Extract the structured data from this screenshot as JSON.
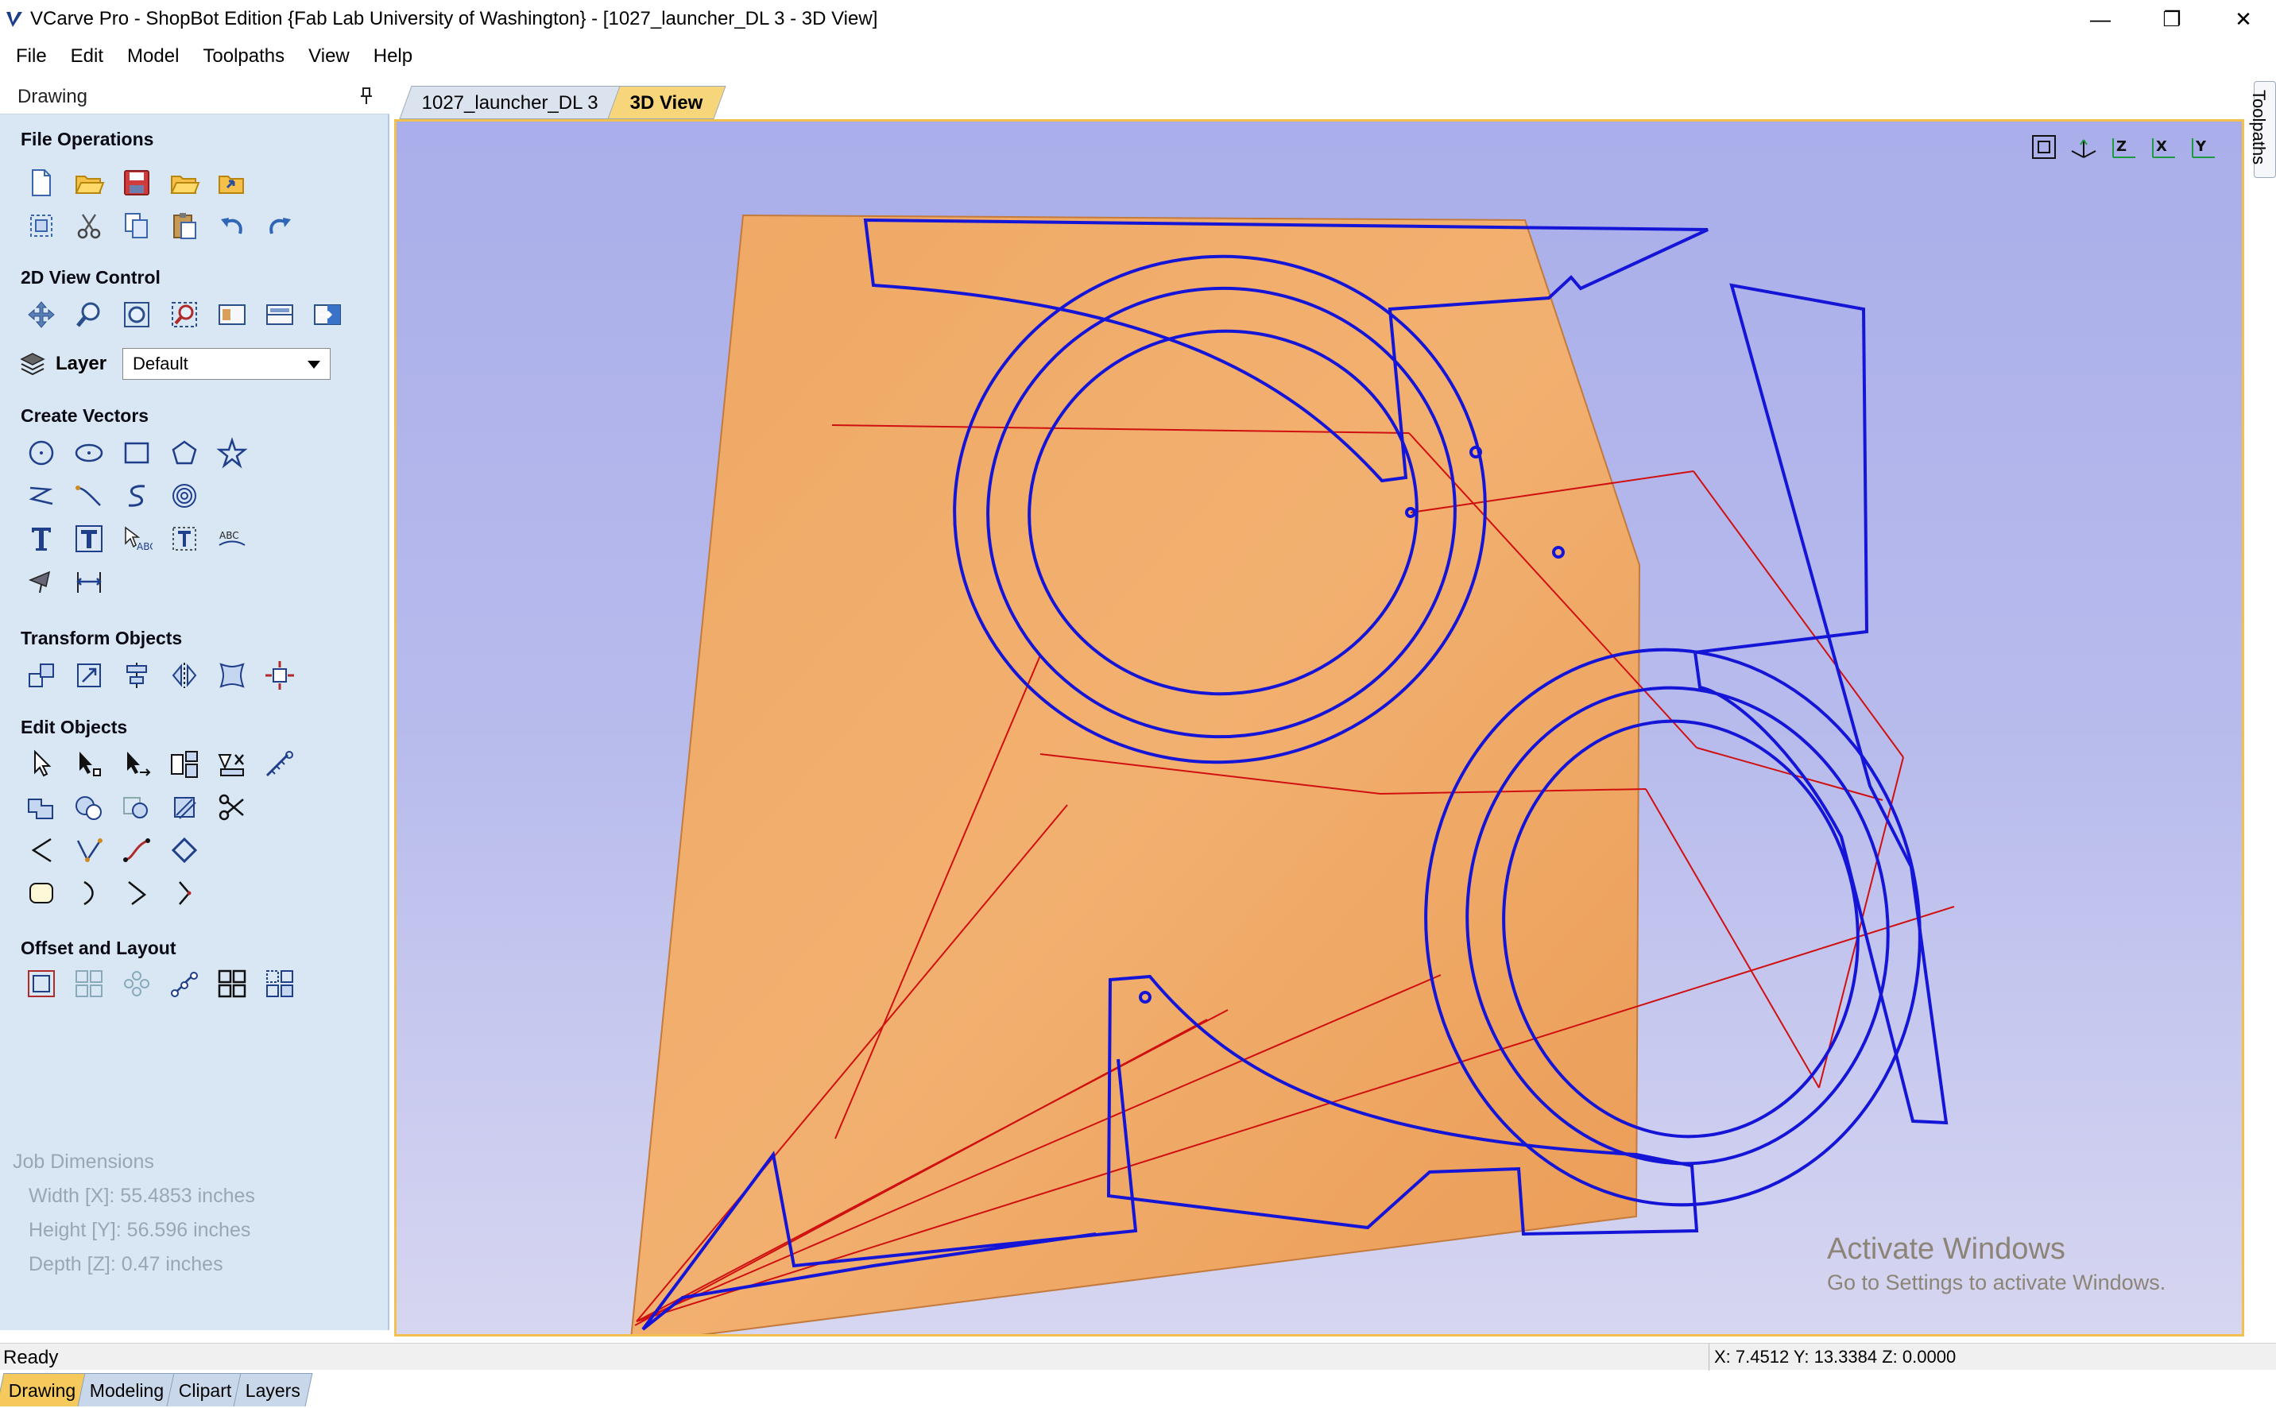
{
  "window": {
    "title": "VCarve Pro - ShopBot Edition {Fab Lab University of Washington} - [1027_launcher_DL 3 - 3D View]",
    "controls": [
      "—",
      "❐",
      "✕"
    ],
    "mdi_controls": [
      "–",
      "▭",
      "✕"
    ]
  },
  "menu": [
    "File",
    "Edit",
    "Model",
    "Toolpaths",
    "View",
    "Help"
  ],
  "panel": {
    "title": "Drawing",
    "sections": {
      "file_ops": "File Operations",
      "view_2d": "2D View Control",
      "create_vectors": "Create Vectors",
      "transform": "Transform Objects",
      "edit": "Edit Objects",
      "offset": "Offset and Layout"
    },
    "layer_label": "Layer",
    "layer_value": "Default",
    "tabs": [
      "Drawing",
      "Modeling",
      "Clipart",
      "Layers"
    ],
    "active_tab": "Drawing"
  },
  "job": {
    "heading": "Job Dimensions",
    "width": "Width  [X]: 55.4853 inches",
    "height": "Height [Y]: 56.596 inches",
    "depth": "Depth  [Z]: 0.47 inches"
  },
  "doc_tabs": [
    "1027_launcher_DL 3",
    "3D View"
  ],
  "active_doc_tab": "3D View",
  "side_tab": "Toolpaths",
  "watermark": {
    "line1": "Activate Windows",
    "line2": "Go to Settings to activate Windows."
  },
  "status": {
    "text": "Ready",
    "coords": "X: 7.4512 Y: 13.3384 Z: 0.0000"
  },
  "colors": {
    "panel_bg": "#d9e7f5",
    "wood": "#f0a35c",
    "vector": "#1515d8",
    "toolpath": "#d01010",
    "active_tab": "#f5c95b"
  }
}
